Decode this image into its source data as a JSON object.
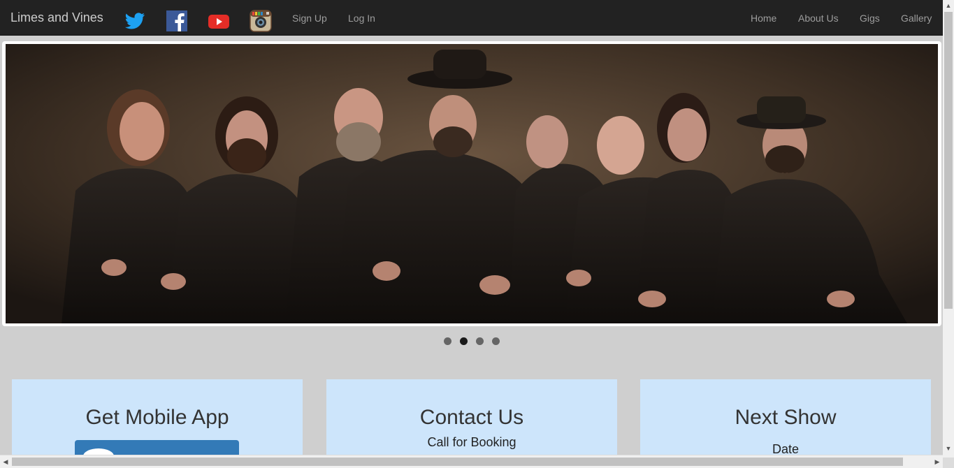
{
  "navbar": {
    "brand": "Limes and Vines",
    "social": [
      "twitter-icon",
      "facebook-icon",
      "youtube-icon",
      "instagram-icon"
    ],
    "left_links": [
      "Sign Up",
      "Log In"
    ],
    "right_links": [
      "Home",
      "About Us",
      "Gigs",
      "Gallery"
    ]
  },
  "carousel": {
    "slide_count": 4,
    "active_index": 1
  },
  "cards": {
    "app": {
      "title": "Get Mobile App"
    },
    "contact": {
      "title": "Contact Us",
      "subtitle": "Call for Booking"
    },
    "show": {
      "title": "Next Show",
      "subtitle": "Date"
    }
  },
  "colors": {
    "navbar_bg": "#222222",
    "page_bg": "#cfcfcf",
    "card_bg": "#cde5fb",
    "button": "#337ab7"
  }
}
